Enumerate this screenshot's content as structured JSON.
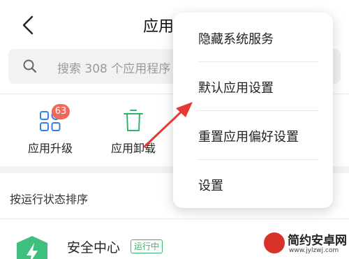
{
  "header": {
    "title": "应用"
  },
  "search": {
    "placeholder": "搜索 308 个应用程序"
  },
  "tools": [
    {
      "label": "应用升级",
      "badge": "63",
      "icon": "apps-grid-icon"
    },
    {
      "label": "应用卸载",
      "icon": "trash-icon"
    }
  ],
  "sort": {
    "label": "按运行状态排序"
  },
  "app": {
    "name": "安全中心",
    "status": "运行中",
    "icon": "shield-bolt-icon"
  },
  "menu": {
    "items": [
      "隐藏系统服务",
      "默认应用设置",
      "重置应用偏好设置",
      "设置"
    ]
  },
  "watermark": {
    "title": "简约安卓网",
    "url": "www.jylzwj.com"
  },
  "colors": {
    "accent_green": "#3db367",
    "badge_red": "#f0685a",
    "annotation_red": "#e53935",
    "icon_blue": "#3b7de0",
    "icon_green": "#2fb46a"
  }
}
